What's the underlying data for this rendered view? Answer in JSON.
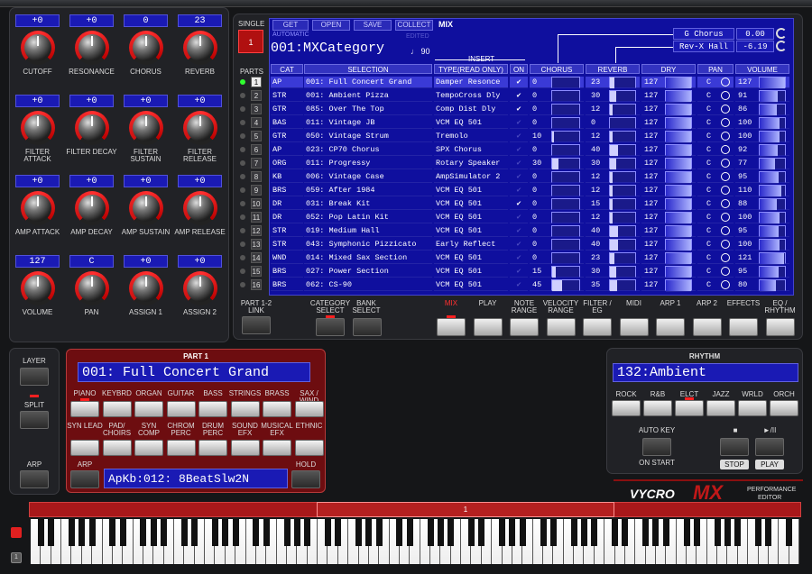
{
  "knobs": [
    [
      {
        "value": "+0",
        "label": "CUTOFF"
      },
      {
        "value": "+0",
        "label": "FILTER ATTACK"
      },
      {
        "value": "+0",
        "label": "AMP ATTACK"
      },
      {
        "value": "127",
        "label": "VOLUME"
      }
    ],
    [
      {
        "value": "+0",
        "label": "RESONANCE"
      },
      {
        "value": "+0",
        "label": "FILTER DECAY"
      },
      {
        "value": "+0",
        "label": "AMP DECAY"
      },
      {
        "value": "C",
        "label": "PAN"
      }
    ],
    [
      {
        "value": "0",
        "label": "CHORUS"
      },
      {
        "value": "+0",
        "label": "FILTER SUSTAIN"
      },
      {
        "value": "+0",
        "label": "AMP SUSTAIN"
      },
      {
        "value": "+0",
        "label": "ASSIGN 1"
      }
    ],
    [
      {
        "value": "23",
        "label": "REVERB"
      },
      {
        "value": "+0",
        "label": "FILTER RELEASE"
      },
      {
        "value": "+0",
        "label": "AMP RELEASE"
      },
      {
        "value": "+0",
        "label": "ASSIGN 2"
      }
    ]
  ],
  "mix": {
    "single_label": "SINGLE",
    "single_value": "1",
    "parts_label": "PARTS",
    "tabs": [
      "GET",
      "OPEN",
      "SAVE",
      "COLLECT"
    ],
    "automatic": "AUTOMATIC",
    "edited": "EDITED",
    "title": "MIX",
    "category_name": "001:MXCategory",
    "note": "♩ 90",
    "insert_label": "INSERT",
    "chorus_type": "G Chorus",
    "chorus_val": "0.00",
    "reverb_type": "Rev-X Hall",
    "reverb_val": "-6.19",
    "headers": [
      "CAT",
      "SELECTION",
      "TYPE(READ ONLY)",
      "ON",
      "CHORUS",
      "REVERB",
      "DRY",
      "PAN",
      "VOLUME"
    ],
    "rows": [
      {
        "n": "1",
        "cat": "AP",
        "sel": "001: Full Concert Grand",
        "type": "Damper Resonce",
        "on": true,
        "ch": "0",
        "chv": 0,
        "rv": "23",
        "rvv": 23,
        "dry": "127",
        "pan": "C",
        "vol": "127",
        "volv": 127
      },
      {
        "n": "2",
        "cat": "STR",
        "sel": "001: Ambient Pizza",
        "type": "TempoCross Dly",
        "on": true,
        "ch": "0",
        "chv": 0,
        "rv": "30",
        "rvv": 30,
        "dry": "127",
        "pan": "C",
        "vol": "91",
        "volv": 91
      },
      {
        "n": "3",
        "cat": "GTR",
        "sel": "085: Over The Top",
        "type": "Comp Dist Dly",
        "on": true,
        "ch": "0",
        "chv": 0,
        "rv": "12",
        "rvv": 12,
        "dry": "127",
        "pan": "C",
        "vol": "86",
        "volv": 86
      },
      {
        "n": "4",
        "cat": "BAS",
        "sel": "011: Vintage JB",
        "type": "VCM EQ 501",
        "on": false,
        "ch": "0",
        "chv": 0,
        "rv": "0",
        "rvv": 0,
        "dry": "127",
        "pan": "C",
        "vol": "100",
        "volv": 100
      },
      {
        "n": "5",
        "cat": "GTR",
        "sel": "050: Vintage Strum",
        "type": "Tremolo",
        "on": false,
        "ch": "10",
        "chv": 10,
        "rv": "12",
        "rvv": 12,
        "dry": "127",
        "pan": "C",
        "vol": "100",
        "volv": 100
      },
      {
        "n": "6",
        "cat": "AP",
        "sel": "023: CP70 Chorus",
        "type": "SPX Chorus",
        "on": false,
        "ch": "0",
        "chv": 0,
        "rv": "40",
        "rvv": 40,
        "dry": "127",
        "pan": "C",
        "vol": "92",
        "volv": 92
      },
      {
        "n": "7",
        "cat": "ORG",
        "sel": "011: Progressy",
        "type": "Rotary Speaker",
        "on": false,
        "ch": "30",
        "chv": 30,
        "rv": "30",
        "rvv": 30,
        "dry": "127",
        "pan": "C",
        "vol": "77",
        "volv": 77
      },
      {
        "n": "8",
        "cat": "KB",
        "sel": "006: Vintage Case",
        "type": "AmpSimulator 2",
        "on": false,
        "ch": "0",
        "chv": 0,
        "rv": "12",
        "rvv": 12,
        "dry": "127",
        "pan": "C",
        "vol": "95",
        "volv": 95
      },
      {
        "n": "9",
        "cat": "BRS",
        "sel": "059: After 1984",
        "type": "VCM EQ 501",
        "on": false,
        "ch": "0",
        "chv": 0,
        "rv": "12",
        "rvv": 12,
        "dry": "127",
        "pan": "C",
        "vol": "110",
        "volv": 110
      },
      {
        "n": "10",
        "cat": "DR",
        "sel": "031: Break Kit",
        "type": "VCM EQ 501",
        "on": true,
        "ch": "0",
        "chv": 0,
        "rv": "15",
        "rvv": 15,
        "dry": "127",
        "pan": "C",
        "vol": "88",
        "volv": 88
      },
      {
        "n": "11",
        "cat": "DR",
        "sel": "052: Pop Latin Kit",
        "type": "VCM EQ 501",
        "on": false,
        "ch": "0",
        "chv": 0,
        "rv": "12",
        "rvv": 12,
        "dry": "127",
        "pan": "C",
        "vol": "100",
        "volv": 100
      },
      {
        "n": "12",
        "cat": "STR",
        "sel": "019: Medium Hall",
        "type": "VCM EQ 501",
        "on": false,
        "ch": "0",
        "chv": 0,
        "rv": "40",
        "rvv": 40,
        "dry": "127",
        "pan": "C",
        "vol": "95",
        "volv": 95
      },
      {
        "n": "13",
        "cat": "STR",
        "sel": "043: Symphonic Pizzicato",
        "type": "Early Reflect",
        "on": false,
        "ch": "0",
        "chv": 0,
        "rv": "40",
        "rvv": 40,
        "dry": "127",
        "pan": "C",
        "vol": "100",
        "volv": 100
      },
      {
        "n": "14",
        "cat": "WND",
        "sel": "014: Mixed Sax Section",
        "type": "VCM EQ 501",
        "on": false,
        "ch": "0",
        "chv": 0,
        "rv": "23",
        "rvv": 23,
        "dry": "127",
        "pan": "C",
        "vol": "121",
        "volv": 121
      },
      {
        "n": "15",
        "cat": "BRS",
        "sel": "027: Power Section",
        "type": "VCM EQ 501",
        "on": false,
        "ch": "15",
        "chv": 15,
        "rv": "30",
        "rvv": 30,
        "dry": "127",
        "pan": "C",
        "vol": "95",
        "volv": 95
      },
      {
        "n": "16",
        "cat": "BRS",
        "sel": "062: CS-90",
        "type": "VCM EQ 501",
        "on": false,
        "ch": "45",
        "chv": 45,
        "rv": "35",
        "rvv": 35,
        "dry": "127",
        "pan": "C",
        "vol": "80",
        "volv": 80
      }
    ],
    "bottom_left": [
      {
        "label": "PART 1-2 LINK"
      },
      {
        "label": "CATEGORY SELECT"
      },
      {
        "label": "BANK SELECT"
      }
    ],
    "modes": [
      "MIX",
      "PLAY",
      "NOTE RANGE",
      "VELOCITY RANGE",
      "FILTER / EG",
      "MIDI",
      "ARP 1",
      "ARP 2",
      "EFFECTS",
      "EQ / RHYTHM"
    ]
  },
  "left_buttons": [
    "LAYER",
    "SPLIT",
    "ARP"
  ],
  "part1": {
    "title": "PART 1",
    "voice": "001: Full Concert Grand",
    "cats1": [
      "PIANO",
      "KEYBRD",
      "ORGAN",
      "GUITAR",
      "BASS",
      "STRINGS",
      "BRASS",
      "SAX / WIND"
    ],
    "cats2": [
      "SYN LEAD",
      "PAD/ CHOIRS",
      "SYN COMP",
      "CHROM PERC",
      "DRUM PERC",
      "SOUND EFX",
      "MUSICAL EFX",
      "ETHNIC"
    ],
    "arp_label": "ARP",
    "arp_value": "ApKb:012: 8BeatSlw2N",
    "hold_label": "HOLD"
  },
  "rhythm": {
    "title": "RHYTHM",
    "value": "132:Ambient",
    "cats": [
      "ROCK",
      "R&B",
      "ELCT",
      "JAZZ",
      "WRLD",
      "ORCH"
    ],
    "auto_key": "AUTO KEY",
    "on_start": "ON START",
    "stop": "STOP",
    "play": "PLAY",
    "stop_sym": "■",
    "play_sym": "►/II"
  },
  "logo": {
    "brand": "VYCRO",
    "mx": "MX",
    "sub1": "PERFORMANCE",
    "sub2": "EDITOR"
  },
  "keyboard": {
    "range_marker": "1",
    "octave_button": "1"
  }
}
